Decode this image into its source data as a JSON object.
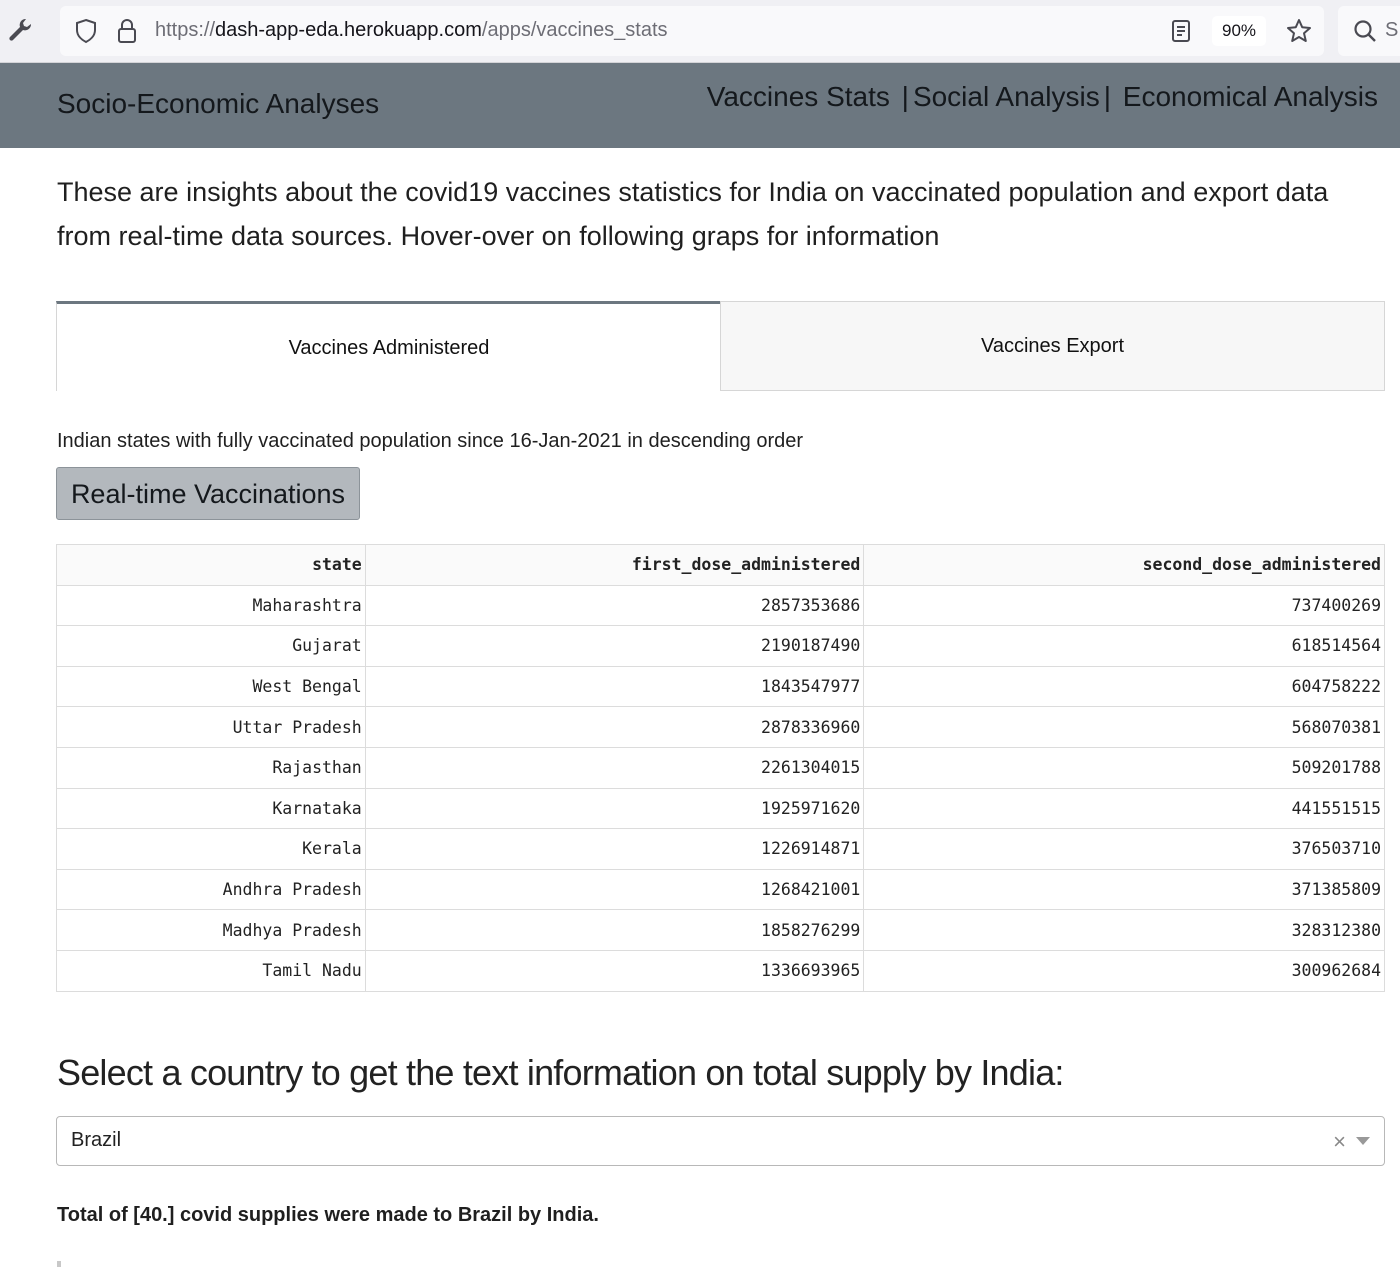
{
  "browser": {
    "url_base": "https://",
    "url_host": "dash-app-eda.herokuapp.com",
    "url_path": "/apps/vaccines_stats",
    "zoom": "90%",
    "search_stub": "S"
  },
  "navbar": {
    "brand": "Socio-Economic Analyses",
    "links": [
      "Vaccines Stats",
      "Social Analysis",
      "Economical Analysis"
    ],
    "separator": "|",
    "background": "#6c7780"
  },
  "intro": "These are insights about the covid19 vaccines statistics for India on vaccinated population and export data from real-time data sources. Hover-over on following graps for information",
  "tabs": [
    {
      "label": "Vaccines Administered",
      "active": true
    },
    {
      "label": "Vaccines Export",
      "active": false
    }
  ],
  "subtitle": "Indian states with fully vaccinated population since 16-Jan-2021 in descending order",
  "realtime_button": "Real-time Vaccinations",
  "table": {
    "columns": [
      "state",
      "first_dose_administered",
      "second_dose_administered"
    ],
    "rows": [
      [
        "Maharashtra",
        "2857353686",
        "737400269"
      ],
      [
        "Gujarat",
        "2190187490",
        "618514564"
      ],
      [
        "West Bengal",
        "1843547977",
        "604758222"
      ],
      [
        "Uttar Pradesh",
        "2878336960",
        "568070381"
      ],
      [
        "Rajasthan",
        "2261304015",
        "509201788"
      ],
      [
        "Karnataka",
        "1925971620",
        "441551515"
      ],
      [
        "Kerala",
        "1226914871",
        "376503710"
      ],
      [
        "Andhra Pradesh",
        "1268421001",
        "371385809"
      ],
      [
        "Madhya Pradesh",
        "1858276299",
        "328312380"
      ],
      [
        "Tamil Nadu",
        "1336693965",
        "300962684"
      ]
    ]
  },
  "select": {
    "heading": "Select a country to get the text information on total supply by India:",
    "value": "Brazil",
    "clear_symbol": "×"
  },
  "result": "Total of [40.] covid supplies were made to Brazil by India."
}
